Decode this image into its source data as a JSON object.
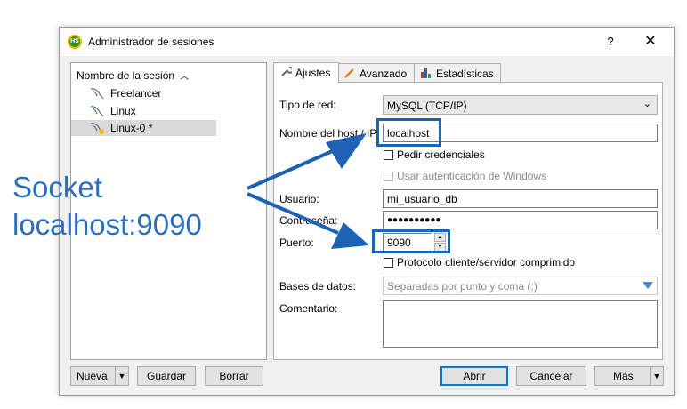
{
  "window": {
    "title": "Administrador de sesiones",
    "help": "?",
    "close": "✕",
    "app_icon_text": "HS"
  },
  "tree": {
    "header": "Nombre de la sesión",
    "sort_indicator": "^",
    "items": [
      {
        "label": "Freelancer",
        "selected": false
      },
      {
        "label": "Linux",
        "selected": false
      },
      {
        "label": "Linux-0 *",
        "selected": true
      }
    ]
  },
  "tabs": [
    {
      "label": "Ajustes",
      "icon": "wrench-icon",
      "active": true
    },
    {
      "label": "Avanzado",
      "icon": "tool-icon",
      "active": false
    },
    {
      "label": "Estadísticas",
      "icon": "bar-chart-icon",
      "active": false
    }
  ],
  "form": {
    "network_type_label": "Tipo de red:",
    "network_type_value": "MySQL (TCP/IP)",
    "host_label": "Nombre del host / IP:",
    "host_value": "localhost",
    "ask_credentials_label": "Pedir credenciales",
    "windows_auth_label": "Usar autenticación de Windows",
    "user_label": "Usuario:",
    "user_value": "mi_usuario_db",
    "password_label": "Contraseña:",
    "password_value": "●●●●●●●●●●",
    "port_label": "Puerto:",
    "port_value": "9090",
    "compressed_label": "Protocolo cliente/servidor comprimido",
    "databases_label": "Bases de datos:",
    "databases_placeholder": "Separadas por punto y coma (;)",
    "comment_label": "Comentario:"
  },
  "buttons": {
    "new": "Nueva",
    "save": "Guardar",
    "delete": "Borrar",
    "open": "Abrir",
    "cancel": "Cancelar",
    "more": "Más"
  },
  "annotation": {
    "line1": "Socket",
    "line2": "localhost:9090",
    "color": "#2a6ebe"
  }
}
